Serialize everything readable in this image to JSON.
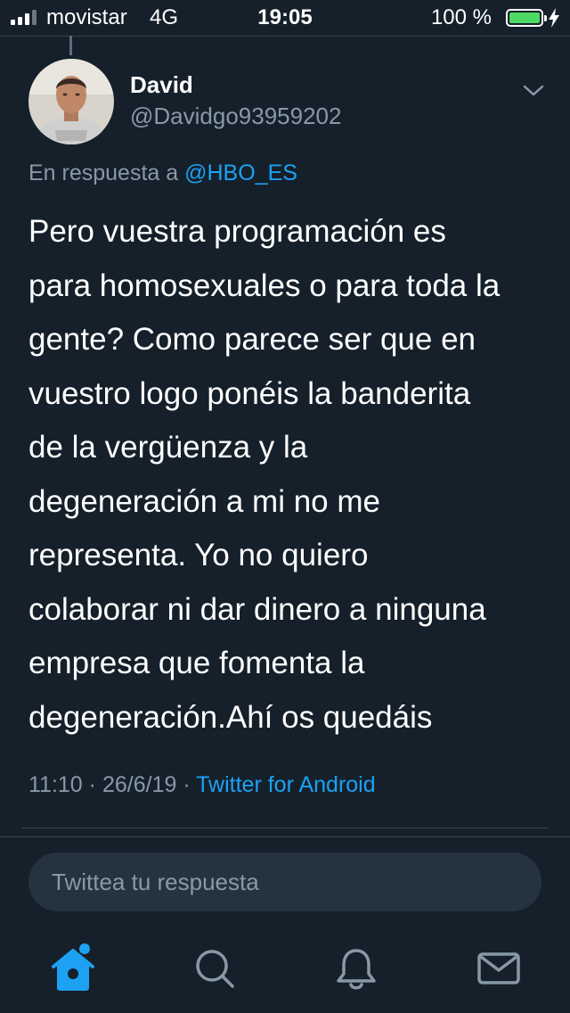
{
  "status_bar": {
    "carrier": "movistar",
    "network": "4G",
    "time": "19:05",
    "battery_percent": "100 %"
  },
  "tweet": {
    "display_name": "David",
    "handle": "@Davidgo93959202",
    "reply_prefix": "En respuesta a",
    "reply_to": "@HBO_ES",
    "text": "Pero vuestra programación es\npara homosexuales o para toda la\ngente? Como parece ser que en\nvuestro logo ponéis la banderita\nde la vergüenza y la\ndegeneración a mi no me\nrepresenta. Yo no quiero\ncolaborar ni dar dinero a ninguna\nempresa que fomenta la\ndegeneración.Ahí os quedáis",
    "time": "11:10",
    "date": "26/6/19",
    "separator": "·",
    "source": "Twitter for Android"
  },
  "composer": {
    "placeholder": "Twittea tu respuesta"
  },
  "tab_bar": {
    "tabs": [
      {
        "icon": "home-icon",
        "active": true
      },
      {
        "icon": "search-icon",
        "active": false
      },
      {
        "icon": "notifications-icon",
        "active": false
      },
      {
        "icon": "messages-icon",
        "active": false
      }
    ]
  },
  "colors": {
    "background": "#15202b",
    "accent": "#1da1f2",
    "secondary_text": "#8899a6",
    "battery": "#4cd964"
  }
}
